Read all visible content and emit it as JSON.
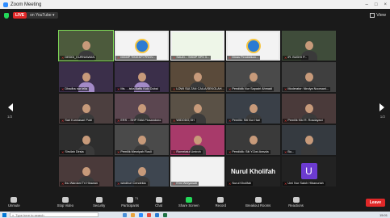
{
  "window": {
    "title": "Zoom Meeting",
    "controls": [
      "–",
      "□",
      "×"
    ]
  },
  "topbar": {
    "live_badge": "LIVE",
    "live_label": "on YouTube ▾",
    "view_label": "View"
  },
  "pagination": {
    "left": "1/2",
    "right": "1/2"
  },
  "tiles": [
    {
      "name": "DEDDI_KURNIAWAN",
      "muted": true,
      "style": "person",
      "bg": "#4c5a3c",
      "active": true
    },
    {
      "name": "MGMP TIK/KKPI PROV...",
      "muted": true,
      "style": "logo",
      "bg": "#e8e8e8"
    },
    {
      "name": "SAUD... SHMP SPS 3...",
      "muted": true,
      "style": "banner",
      "bg": "#f0f0f0"
    },
    {
      "name": "Dinas Pendidikan...",
      "muted": true,
      "style": "logo",
      "bg": "#e8e8e8"
    },
    {
      "name": "IR. BUDHI P...",
      "muted": true,
      "style": "person",
      "bg": "#3f4c3a"
    },
    {
      "name": "Dhadha nur lelia",
      "muted": true,
      "style": "webinar",
      "bg": "#3b2f4a"
    },
    {
      "name": "Ms. ...istia Baffu Koki Dubai",
      "muted": true,
      "style": "webinar",
      "bg": "#3b2f4a"
    },
    {
      "name": "LOWI SULTAN CAILA/SEKOLAH...",
      "muted": true,
      "style": "person",
      "bg": "#5a4a3a"
    },
    {
      "name": "Pendidik Nur Sapadri Ahmadi",
      "muted": true,
      "style": "person",
      "bg": "#4a4a4a"
    },
    {
      "name": "Moderator: Nindya Noorsani...",
      "muted": true,
      "style": "person",
      "bg": "#3f3f3f"
    },
    {
      "name": "Sari Kurniasari Putri",
      "muted": true,
      "style": "person",
      "bg": "#4c3f3f"
    },
    {
      "name": "ERS ...SHP SMA Plosandono",
      "muted": true,
      "style": "person",
      "bg": "#5b4650"
    },
    {
      "name": "WIDODO,SH",
      "muted": true,
      "style": "person",
      "bg": "#5a5146"
    },
    {
      "name": "Pemilik: Siti Nur Hari",
      "muted": true,
      "style": "person",
      "bg": "#3a4048"
    },
    {
      "name": "Pemilik Kiki R. Rosdayani",
      "muted": true,
      "style": "person",
      "bg": "#4a3a3a"
    },
    {
      "name": "Sirsilah Dirsia",
      "muted": true,
      "style": "person",
      "bg": "#2e2e2e"
    },
    {
      "name": "Pemilik Mesriyah Rusli",
      "muted": true,
      "style": "person",
      "bg": "#4a4a4a"
    },
    {
      "name": "Romelatul Umiroh",
      "muted": true,
      "style": "person",
      "bg": "#a83a6a"
    },
    {
      "name": "Pendidik: Siti Y.Dwi Aravda",
      "muted": true,
      "style": "person",
      "bg": "#3a3a3a"
    },
    {
      "name": "Bu...",
      "muted": true,
      "style": "person",
      "bg": "#353a40"
    },
    {
      "name": "Ibu Wardani Tri Hirawan",
      "muted": true,
      "style": "person",
      "bg": "#4a3a3a"
    },
    {
      "name": "windhuri Cendekia",
      "muted": true,
      "style": "person",
      "bg": "#3e4650"
    },
    {
      "name": "Elmi Widyawati",
      "muted": true,
      "style": "collage",
      "bg": "#e9e9e9"
    },
    {
      "name": "Nurul Kholifah",
      "muted": true,
      "style": "name-only",
      "bg": "#222222",
      "big_label": "Nurul Kholifah"
    },
    {
      "name": "Umi Nur Satoh Hibanuriah",
      "muted": true,
      "style": "avatar",
      "bg": "#222222",
      "avatar_letter": "U"
    }
  ],
  "toolbar": {
    "items": [
      {
        "label": "Unmute",
        "icon": "mic-icon"
      },
      {
        "label": "Stop Video",
        "icon": "video-icon"
      },
      {
        "label": "Security",
        "icon": "shield-icon"
      },
      {
        "label": "Participants",
        "icon": "participants-icon",
        "badge": "71"
      },
      {
        "label": "Chat",
        "icon": "chat-icon"
      },
      {
        "label": "Share Screen",
        "icon": "share-screen-icon",
        "green": true
      },
      {
        "label": "Record",
        "icon": "record-icon"
      },
      {
        "label": "Breakout Rooms",
        "icon": "breakout-rooms-icon"
      },
      {
        "label": "Reactions",
        "icon": "reactions-icon"
      }
    ],
    "leave_label": "Leave"
  },
  "taskbar": {
    "search_placeholder": "Type here to search",
    "clock": "15:01",
    "date": "..."
  },
  "colors": {
    "accent_green": "#23d959",
    "leave_red": "#e02828",
    "active_tile_border": "#7ed957"
  }
}
